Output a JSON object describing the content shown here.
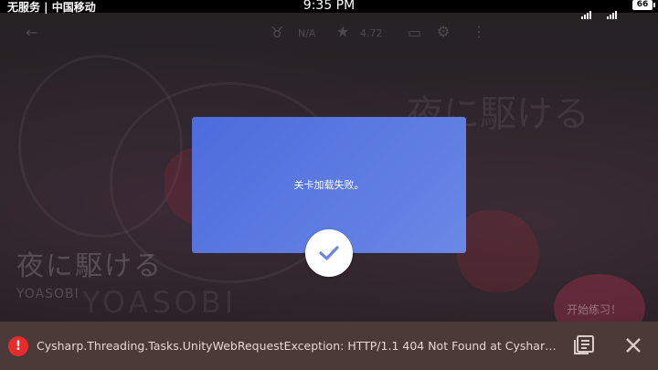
{
  "status_bar": {
    "carrier": "无服务 | 中国移动",
    "time": "9:35 PM",
    "battery": "66"
  },
  "background": {
    "song_title": "夜に駆ける",
    "artist": "YOASOBI",
    "big_title": "夜に駆ける",
    "big_text": "YOASOBI",
    "na_label": "N/A",
    "rating": "4.72",
    "start_button_label": "开始练习！"
  },
  "dialog": {
    "message": "关卡加载失败。"
  },
  "error_bar": {
    "message": "Cysharp.Threading.Tasks.UnityWebRequestException: HTTP/1.1 404 Not Found   at Cysharp.Threading.Tasks.UnityWebRequestException..."
  },
  "colors": {
    "dialog_start": "#4d6cdc",
    "dialog_end": "#6a88e6",
    "error_bar_bg": "#4b3a38",
    "error_icon": "#e52b2b"
  }
}
